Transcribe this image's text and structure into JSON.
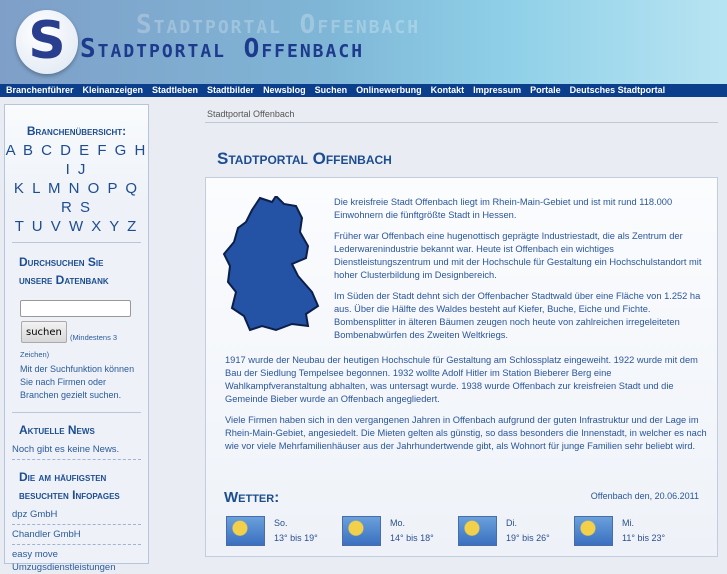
{
  "header": {
    "logo_letter": "S",
    "title": "Stadtportal Offenbach",
    "ghost_title": "Stadtportal Offenbach"
  },
  "nav": [
    "Branchenführer",
    "Kleinanzeigen",
    "Stadtleben",
    "Stadtbilder",
    "Newsblog",
    "Suchen",
    "Onlinewerbung",
    "Kontakt",
    "Impressum",
    "Portale",
    "Deutsches Stadtportal"
  ],
  "sidebar": {
    "branch_title": "Branchenübersicht:",
    "alpha_rows": [
      "A B C D E F G H I J",
      "K L M N O P Q R S",
      "T U V W X Y Z"
    ],
    "search_title_1": "Durchsuchen Sie",
    "search_title_2": "unsere Datenbank",
    "search_value": "",
    "search_button": "suchen",
    "search_hint": "(Mindestens 3 Zeichen)",
    "search_desc": "Mit der Suchfunktion können Sie nach Firmen oder Branchen gezielt suchen.",
    "news_title": "Aktuelle News",
    "news_text": "Noch gibt es keine News.",
    "top_title_1": "Die am häufigsten",
    "top_title_2": "besuchten Infopages",
    "top": [
      "dpz GmbH",
      "Chandler GmbH",
      "easy move Umzugsdienstleistungen"
    ]
  },
  "breadcrumb": "Stadtportal Offenbach",
  "main": {
    "title": "Stadtportal Offenbach",
    "paragraphs": [
      "Die kreisfreie Stadt Offenbach liegt im Rhein-Main-Gebiet und ist mit rund 118.000 Einwohnern die fünftgrößte Stadt in Hessen.",
      "Früher war Offenbach eine hugenottisch geprägte Industriestadt, die als Zentrum der Lederwarenindustrie bekannt war. Heute ist Offenbach ein wichtiges Dienstleistungszentrum und mit der Hochschule für Gestaltung ein Hochschulstandort mit hoher Clusterbildung im Designbereich.",
      "Im Süden der Stadt dehnt sich der Offenbacher Stadtwald über eine Fläche von 1.252 ha aus. Über die Hälfte des Waldes besteht auf Kiefer, Buche, Eiche und Fichte. Bombensplitter in älteren Bäumen zeugen noch heute von zahlreichen irregeleiteten Bombenabwürfen des Zweiten Weltkriegs.",
      "1917 wurde der Neubau der heutigen Hochschule für Gestaltung am Schlossplatz eingeweiht. 1922 wurde mit dem Bau der Siedlung Tempelsee begonnen. 1932 wollte Adolf Hitler im Station Bieberer Berg eine Wahlkampfveranstaltung abhalten, was untersagt wurde. 1938 wurde Offenbach zur kreisfreien Stadt und die Gemeinde Bieber wurde an Offenbach angegliedert.",
      "Viele Firmen haben sich in den vergangenen Jahren in Offenbach aufgrund der guten Infrastruktur und der Lage im Rhein-Main-Gebiet, angesiedelt. Die Mieten gelten als günstig, so dass besonders die Innenstadt, in welcher es nach wie vor viele Mehrfamilienhäuser aus der Jahrhundertwende gibt, als Wohnort für junge Familien sehr beliebt wird."
    ]
  },
  "weather": {
    "title": "Wetter:",
    "date": "Offenbach den, 20.06.2011",
    "days": [
      {
        "day": "So.",
        "temp": "13° bis 19°"
      },
      {
        "day": "Mo.",
        "temp": "14° bis 18°"
      },
      {
        "day": "Di.",
        "temp": "19° bis 26°"
      },
      {
        "day": "Mi.",
        "temp": "11° bis 23°"
      }
    ]
  }
}
